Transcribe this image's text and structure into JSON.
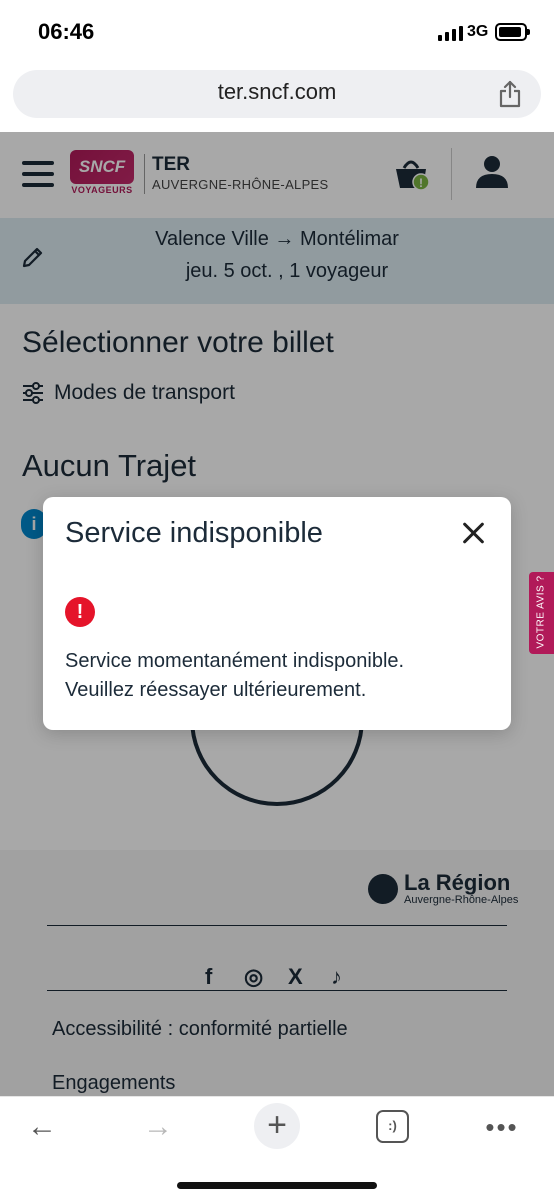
{
  "status_bar": {
    "time": "06:46",
    "network": "3G"
  },
  "browser": {
    "url": "ter.sncf.com"
  },
  "header": {
    "logo_text": "SNCF",
    "logo_sub": "VOYAGEURS",
    "title": "TER",
    "region": "AUVERGNE-RHÔNE-ALPES",
    "basket_badge": "!"
  },
  "trip": {
    "route": "Valence Ville → Montélimar",
    "details": "jeu. 5 oct. , 1 voyageur"
  },
  "main": {
    "section_title": "Sélectionner votre billet",
    "filter_label": "Modes de transport",
    "no_trip_title": "Aucun Trajet",
    "info_icon": "i"
  },
  "feedback_tab": "VOTRE AVIS ?",
  "footer": {
    "region_name": "La Région",
    "region_sub": "Auvergne-Rhône-Alpes",
    "social": [
      "f",
      "◎",
      "X",
      "♪"
    ],
    "links": [
      "Accessibilité : conformité partielle",
      "Engagements"
    ]
  },
  "modal": {
    "title": "Service indisponible",
    "error_icon": "!",
    "message_line1": "Service momentanément indisponible.",
    "message_line2": "Veuillez réessayer ultérieurement."
  },
  "toolbar": {
    "back": "←",
    "forward": "→",
    "new_tab": "+",
    "tabs": ":)",
    "more": "•••"
  }
}
